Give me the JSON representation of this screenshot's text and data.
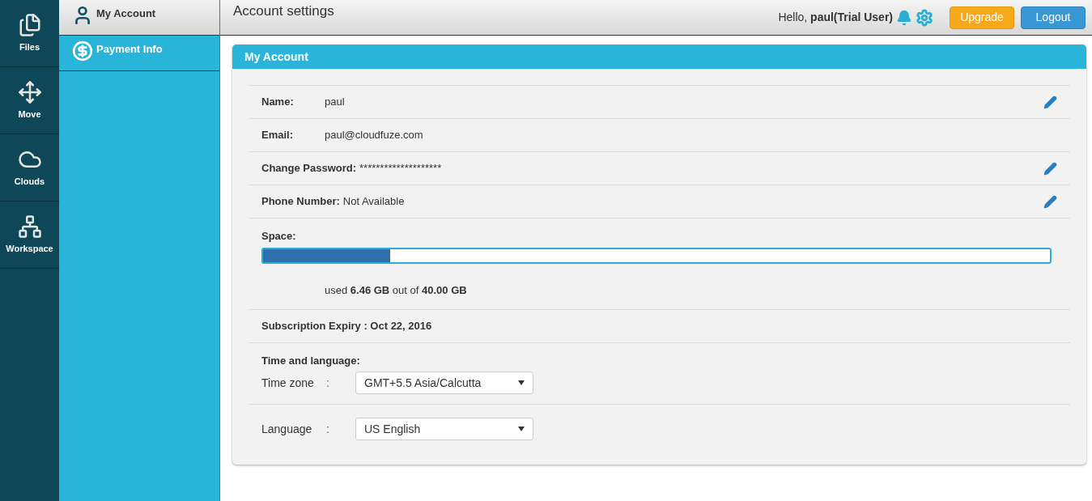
{
  "rail": [
    {
      "label": "Files",
      "kind": "files",
      "selected": false
    },
    {
      "label": "Move",
      "kind": "move",
      "selected": false
    },
    {
      "label": "Clouds",
      "kind": "clouds",
      "selected": false
    },
    {
      "label": "Workspace",
      "kind": "workspace",
      "selected": false
    }
  ],
  "submenu": [
    {
      "label": "My Account",
      "kind": "account",
      "selected": true
    },
    {
      "label": "Payment Info",
      "kind": "payment",
      "selected": false
    }
  ],
  "header": {
    "title": "Account settings",
    "greeting": "Hello, **paul(Trial User)**",
    "buttons": [
      {
        "label": "Upgrade",
        "kind": "upgrade"
      },
      {
        "label": "Logout",
        "kind": "logout"
      }
    ]
  },
  "panel": {
    "title": "My Account",
    "rows": [
      {
        "kind": "field",
        "label": "Name:",
        "value": "paul",
        "editable": true
      },
      {
        "kind": "field",
        "label": "Email:",
        "value": "paul@cloudfuze.com",
        "editable": false
      },
      {
        "kind": "field",
        "label": "Change Password:",
        "value": "********************",
        "editable": true
      },
      {
        "kind": "field",
        "label": "Phone Number:",
        "value": "Not Available",
        "editable": true
      },
      {
        "kind": "space",
        "label": "Space:",
        "level": 0.162,
        "usage": "used **6.46 GB** out of **40.00 GB**"
      },
      {
        "kind": "expiry",
        "label": "Subscription Expiry : Oct 22, 2016"
      }
    ],
    "time_language": {
      "heading": "Time and language:",
      "selects": [
        {
          "label": "Time zone",
          "separator": ":",
          "value": "GMT+5.5 Asia/Calcutta"
        },
        {
          "label": "Language",
          "separator": ":",
          "value": "US English"
        }
      ]
    }
  }
}
